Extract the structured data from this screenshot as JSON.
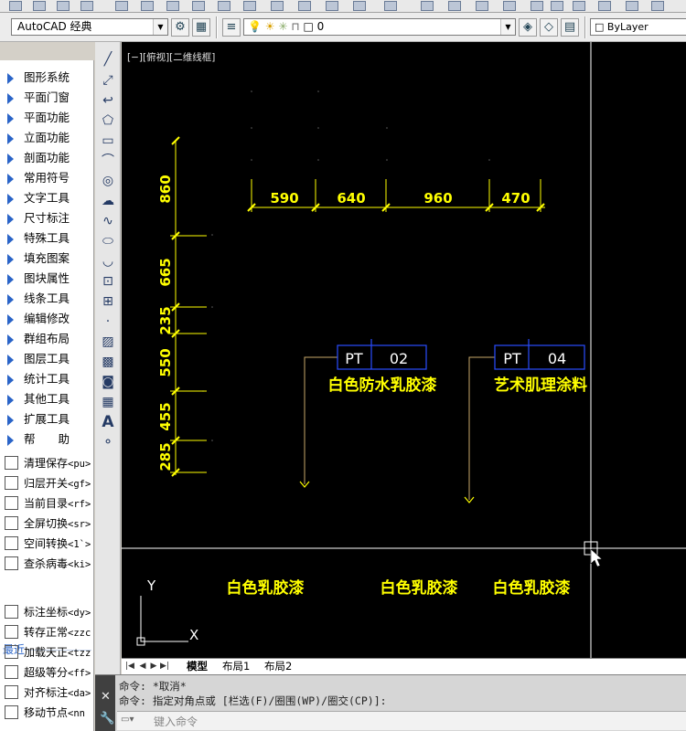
{
  "toolbar": {
    "workspace": "AutoCAD 经典",
    "layer": "0",
    "linetype": "ByLayer"
  },
  "left_menu": {
    "items": [
      "图形系统",
      "平面门窗",
      "平面功能",
      "立面功能",
      "剖面功能",
      "常用符号",
      "文字工具",
      "尺寸标注",
      "特殊工具",
      "填充图案",
      "图块属性",
      "线条工具",
      "编辑修改",
      "群组布局",
      "图层工具",
      "统计工具",
      "其他工具",
      "扩展工具",
      "帮　　助"
    ],
    "commands": [
      {
        "label": "清理保存",
        "tag": "<pu>",
        "icon": "save-icon"
      },
      {
        "label": "归层开关",
        "tag": "<gf>",
        "icon": "layers-icon"
      },
      {
        "label": "当前目录",
        "tag": "<rf>",
        "icon": "dwg-folder-icon"
      },
      {
        "label": "全屏切换",
        "tag": "<sr>",
        "icon": "fullscreen-icon"
      },
      {
        "label": "空间转换",
        "tag": "<1`>",
        "icon": "globe-icon"
      },
      {
        "label": "查杀病毒",
        "tag": "<ki>",
        "icon": "shield-icon"
      }
    ],
    "recent_label": "最近",
    "recent": [
      {
        "label": "标注坐标",
        "tag": "<dy>",
        "icon": "coordinate-icon"
      },
      {
        "label": "转存正常",
        "tag": "<zzc",
        "icon": "convert-icon"
      },
      {
        "label": "加载天正",
        "tag": "<tzz",
        "icon": "load-icon"
      },
      {
        "label": "超级等分",
        "tag": "<ff>",
        "icon": "divide-icon"
      },
      {
        "label": "对齐标注",
        "tag": "<da>",
        "icon": "align-dimension-icon"
      },
      {
        "label": "移动节点",
        "tag": "<nn",
        "icon": "move-node-icon"
      }
    ]
  },
  "viewport_label": "[−][俯视][二维线框]",
  "drawing": {
    "horizontal_dims": [
      "590",
      "640",
      "960",
      "470"
    ],
    "vertical_dims": [
      "860",
      "665",
      "235",
      "550",
      "455",
      "285"
    ],
    "tags": [
      {
        "code": "PT",
        "num": "02",
        "desc": "白色防水乳胶漆"
      },
      {
        "code": "PT",
        "num": "04",
        "desc": "艺术肌理涂料"
      }
    ],
    "bottom_labels": [
      "白色乳胶漆",
      "白色乳胶漆",
      "白色乳胶漆"
    ],
    "ucs": {
      "x": "X",
      "y": "Y"
    },
    "colors": {
      "annotation": "#ffff00",
      "tag_box": "#2a4cff",
      "leader": "#c8a86a",
      "background": "#000000"
    }
  },
  "tabs": [
    "模型",
    "布局1",
    "布局2"
  ],
  "command": {
    "line1": "命令: *取消*",
    "line2": "命令: 指定对角点或 [栏选(F)/圈围(WP)/圈交(CP)]:",
    "placeholder": "键入命令"
  }
}
